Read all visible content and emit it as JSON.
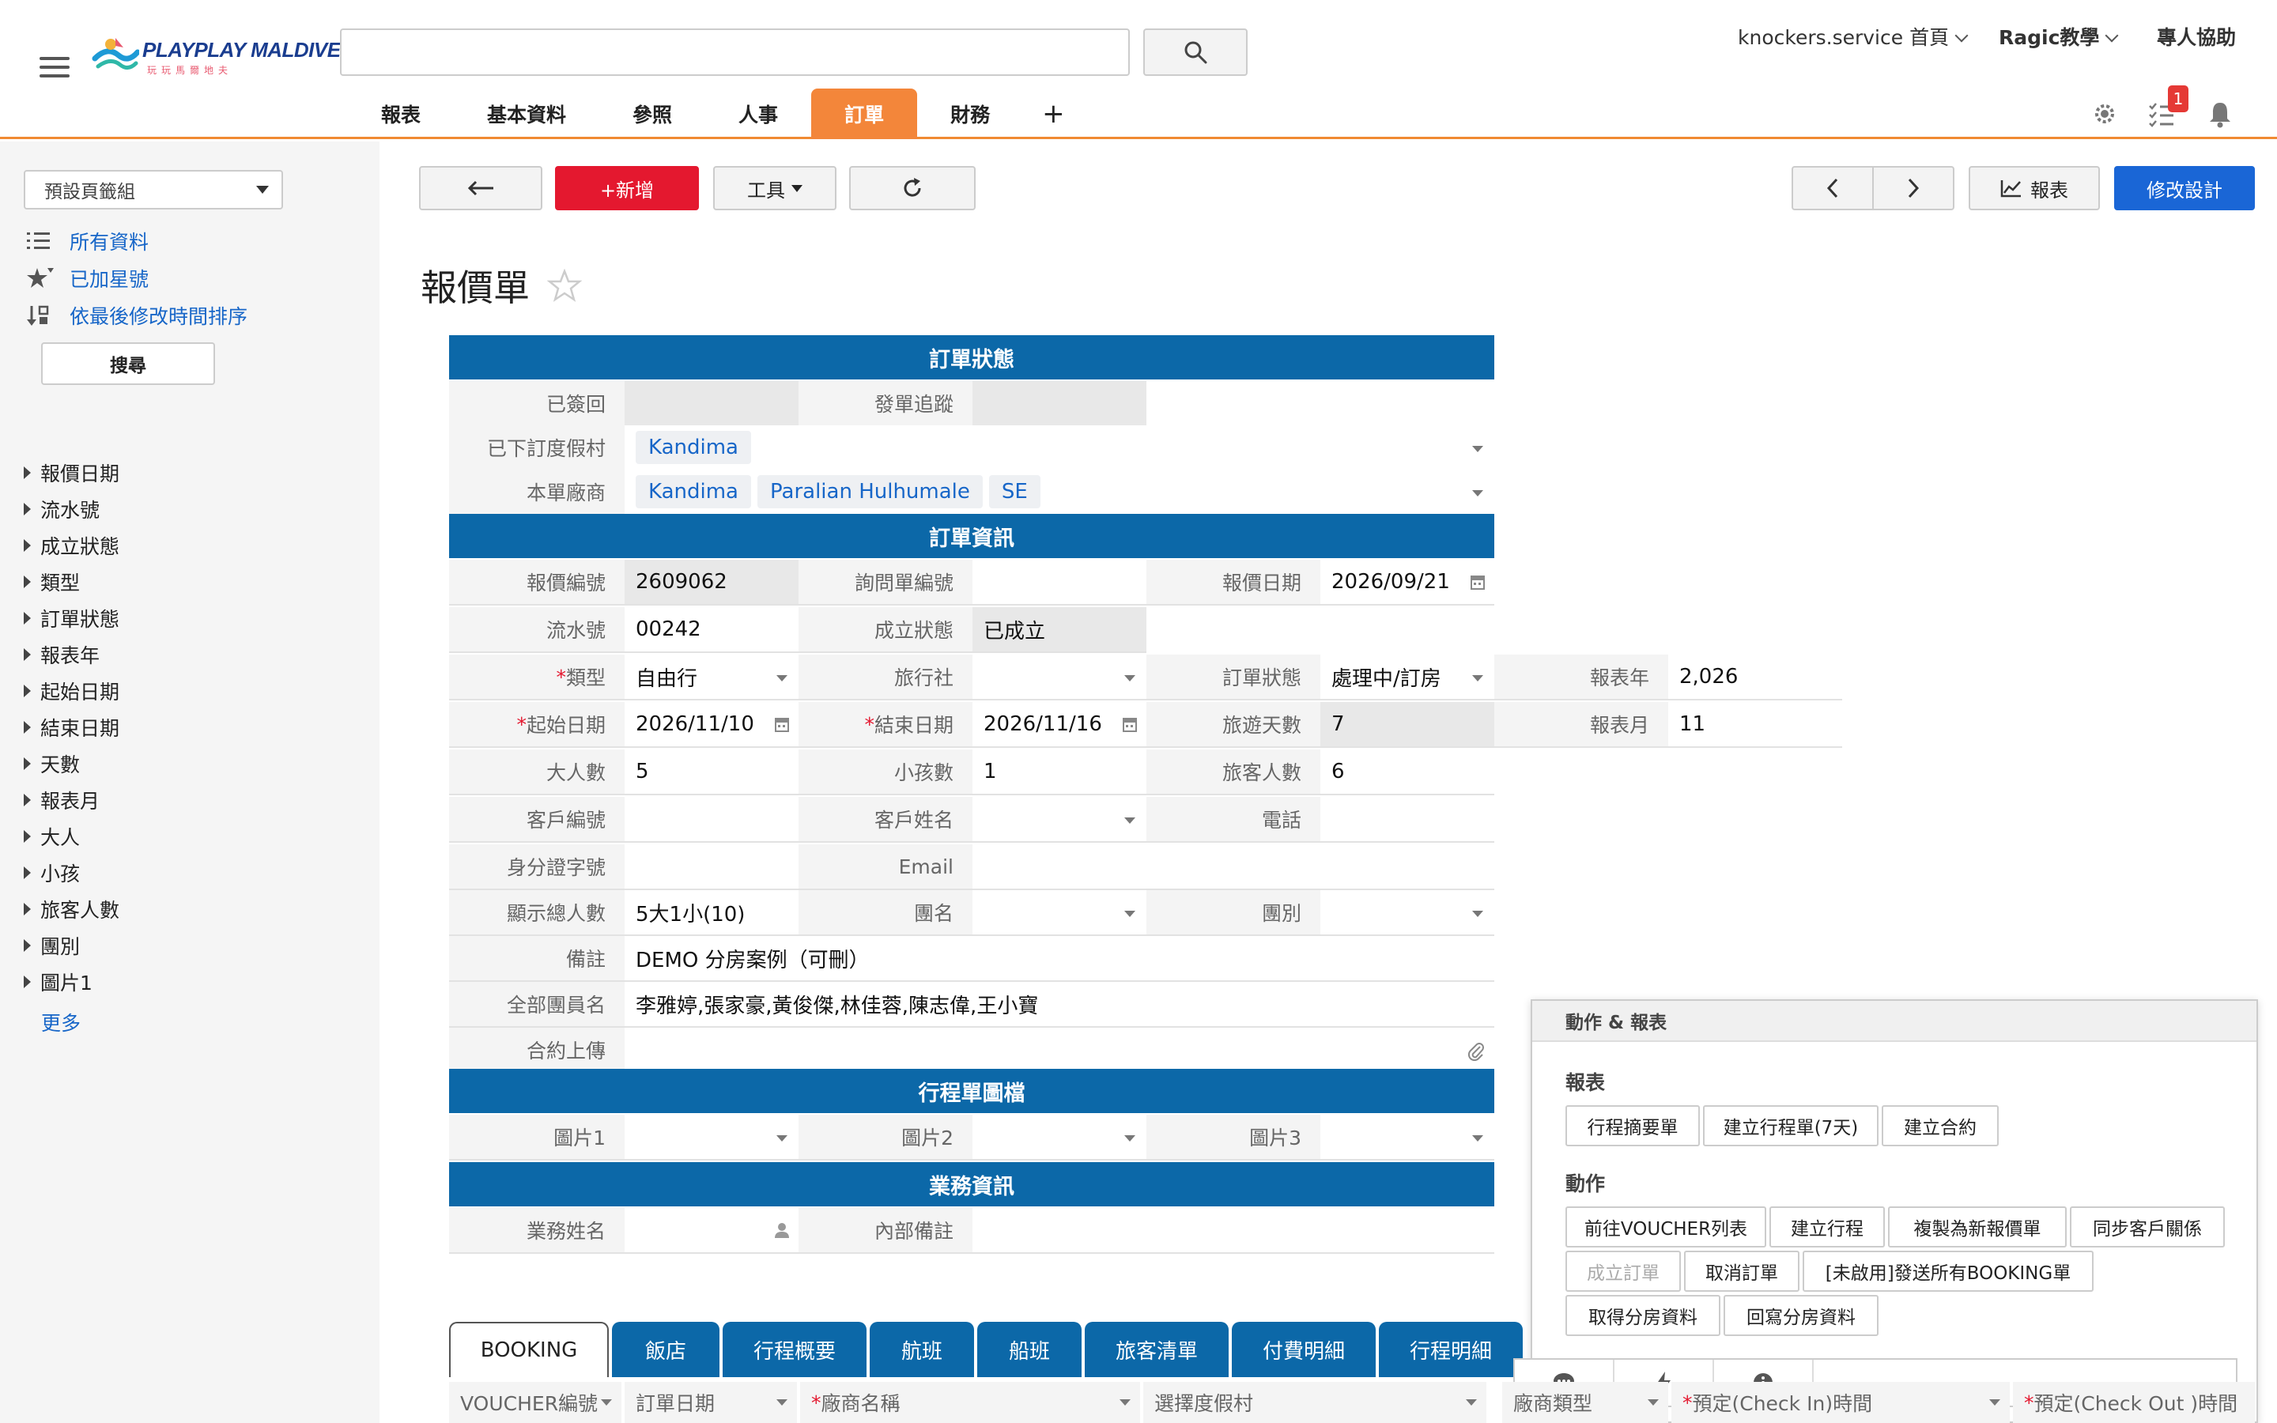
{
  "header": {
    "logo_text": "PLAYPLAY MALDIVES",
    "logo_sub": "玩玩馬爾地夫",
    "search_placeholder": "",
    "account_link": "knockers.service 首頁",
    "tutorial_link": "Ragic教學",
    "help_link": "專人協助",
    "notification_count": "1"
  },
  "nav": {
    "tabs": [
      {
        "label": "報表"
      },
      {
        "label": "基本資料"
      },
      {
        "label": "參照"
      },
      {
        "label": "人事"
      },
      {
        "label": "訂單"
      },
      {
        "label": "財務"
      },
      {
        "label": "+"
      }
    ],
    "active_tab": "訂單"
  },
  "sidebar": {
    "tab_group": "預設頁籤組",
    "links": [
      {
        "label": "所有資料",
        "icon": "list-icon"
      },
      {
        "label": "已加星號",
        "icon": "star-icon"
      },
      {
        "label": "依最後修改時間排序",
        "icon": "sort-icon"
      }
    ],
    "search_button": "搜尋",
    "filters": [
      "報價日期",
      "流水號",
      "成立狀態",
      "類型",
      "訂單狀態",
      "報表年",
      "起始日期",
      "結束日期",
      "天數",
      "報表月",
      "大人",
      "小孩",
      "旅客人數",
      "團別",
      "圖片1"
    ],
    "more": "更多"
  },
  "toolbar": {
    "back_icon": "arrow-left-icon",
    "new_label": "+新增",
    "tools_label": "工具",
    "refresh_icon": "refresh-icon",
    "prev_icon": "chevron-left-icon",
    "next_icon": "chevron-right-icon",
    "report_label": "報表",
    "design_label": "修改設計"
  },
  "page": {
    "title": "報價單"
  },
  "form": {
    "sections": {
      "order_status": "訂單狀態",
      "order_info": "訂單資訊",
      "itinerary_images": "行程單圖檔",
      "business_info": "業務資訊"
    },
    "fields": {
      "signed_back": {
        "label": "已簽回",
        "value": ""
      },
      "dispatch_tracking": {
        "label": "發單追蹤",
        "value": ""
      },
      "booked_resort": {
        "label": "已下訂度假村",
        "tags": [
          "Kandima"
        ]
      },
      "vendors": {
        "label": "本單廠商",
        "tags": [
          "Kandima",
          "Paralian Hulhumale",
          "SE"
        ]
      },
      "quote_no": {
        "label": "報價編號",
        "value": "2609062"
      },
      "inquiry_no": {
        "label": "詢問單編號",
        "value": ""
      },
      "quote_date": {
        "label": "報價日期",
        "value": "2026/09/21"
      },
      "serial_no": {
        "label": "流水號",
        "value": "00242"
      },
      "established_status": {
        "label": "成立狀態",
        "value": "已成立"
      },
      "type": {
        "label": "類型",
        "value": "自由行"
      },
      "agency": {
        "label": "旅行社",
        "value": ""
      },
      "order_status": {
        "label": "訂單狀態",
        "value": "處理中/訂房"
      },
      "report_year": {
        "label": "報表年",
        "value": "2,026"
      },
      "start_date": {
        "label": "起始日期",
        "value": "2026/11/10"
      },
      "end_date": {
        "label": "結束日期",
        "value": "2026/11/16"
      },
      "trip_days": {
        "label": "旅遊天數",
        "value": "7"
      },
      "report_month": {
        "label": "報表月",
        "value": "11"
      },
      "adults": {
        "label": "大人數",
        "value": "5"
      },
      "children": {
        "label": "小孩數",
        "value": "1"
      },
      "travelers": {
        "label": "旅客人數",
        "value": "6"
      },
      "customer_no": {
        "label": "客戶編號",
        "value": ""
      },
      "customer_name": {
        "label": "客戶姓名",
        "value": ""
      },
      "phone": {
        "label": "電話",
        "value": ""
      },
      "id_no": {
        "label": "身分證字號",
        "value": ""
      },
      "email": {
        "label": "Email",
        "value": ""
      },
      "total_display": {
        "label": "顯示總人數",
        "value": "5大1小(10)"
      },
      "group_name": {
        "label": "團名",
        "value": ""
      },
      "group_type": {
        "label": "團別",
        "value": ""
      },
      "notes": {
        "label": "備註",
        "value": "DEMO 分房案例（可刪）"
      },
      "members": {
        "label": "全部團員名",
        "value": "李雅婷,張家豪,黃俊傑,林佳蓉,陳志偉,王小寶"
      },
      "contract_upload": {
        "label": "合約上傳",
        "value": ""
      },
      "image1": {
        "label": "圖片1",
        "value": ""
      },
      "image2": {
        "label": "圖片2",
        "value": ""
      },
      "image3": {
        "label": "圖片3",
        "value": ""
      },
      "sales_name": {
        "label": "業務姓名",
        "value": ""
      },
      "internal_notes": {
        "label": "內部備註",
        "value": ""
      }
    },
    "required_mark": "*"
  },
  "action_panel": {
    "title": "動作 & 報表",
    "reports_heading": "報表",
    "reports": [
      "行程摘要單",
      "建立行程單(7天)",
      "建立合約"
    ],
    "actions_heading": "動作",
    "actions": [
      "前往VOUCHER列表",
      "建立行程",
      "複製為新報價單",
      "同步客戶關係",
      "成立訂單",
      "取消訂單",
      "[未啟用]發送所有BOOKING單",
      "取得分房資料",
      "回寫分房資料"
    ]
  },
  "subtables": {
    "tabs": [
      "BOOKING",
      "飯店",
      "行程概要",
      "航班",
      "船班",
      "旅客清單",
      "付費明細",
      "行程明細"
    ],
    "active_tab": "BOOKING",
    "columns": [
      "VOUCHER編號",
      "訂單日期",
      "廠商名稱",
      "選擇度假村",
      "廠商類型",
      "預定(Check In)時間",
      "預定(Check Out )時間"
    ]
  },
  "colors": {
    "accent_orange": "#f3863a",
    "section_blue": "#0c68a8",
    "new_red": "#e4182f",
    "design_blue": "#1a66d6",
    "link_blue": "#1766c8"
  }
}
